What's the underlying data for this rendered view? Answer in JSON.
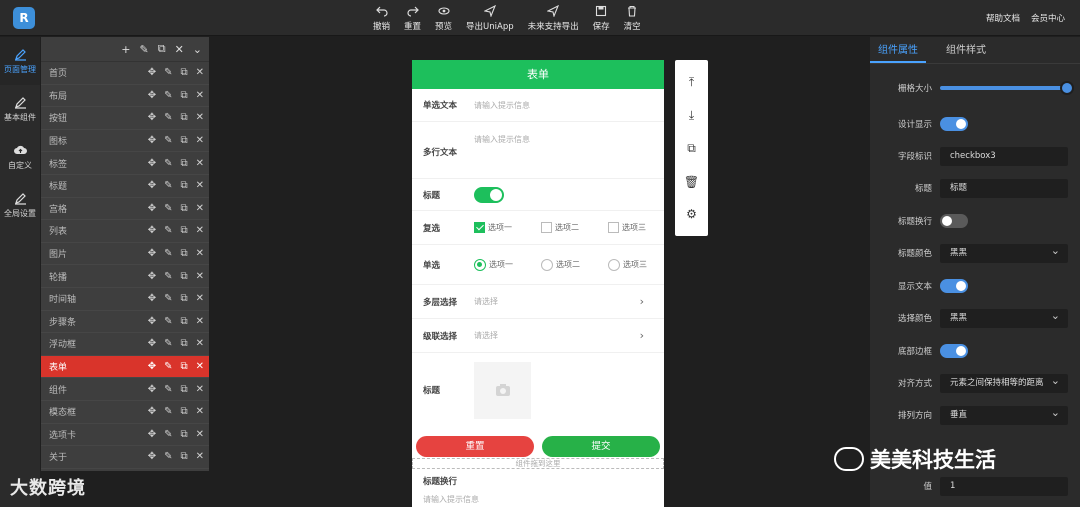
{
  "topbar": {
    "tools": [
      {
        "label": "撤销",
        "icon": "undo-icon"
      },
      {
        "label": "重置",
        "icon": "redo-icon"
      },
      {
        "label": "预览",
        "icon": "eye-icon"
      },
      {
        "label": "导出UniApp",
        "icon": "send-icon"
      },
      {
        "label": "未来支持导出",
        "icon": "send-icon"
      },
      {
        "label": "保存",
        "icon": "save-icon"
      },
      {
        "label": "清空",
        "icon": "trash-icon"
      }
    ],
    "help": "帮助文档",
    "member": "会员中心"
  },
  "rail": [
    {
      "label": "页面管理",
      "icon": "pen-icon"
    },
    {
      "label": "基本组件",
      "icon": "pen-icon"
    },
    {
      "label": "自定义",
      "icon": "cloud-upload-icon"
    },
    {
      "label": "全局设置",
      "icon": "pen-icon"
    }
  ],
  "pages": [
    "首页",
    "布局",
    "按钮",
    "图标",
    "标签",
    "标题",
    "宫格",
    "列表",
    "图片",
    "轮播",
    "时间轴",
    "步骤条",
    "浮动框",
    "表单",
    "组件",
    "模态框",
    "选项卡",
    "关于"
  ],
  "active_page": "表单",
  "form": {
    "title": "表单",
    "single_text": {
      "label": "单选文本",
      "placeholder": "请输入提示信息"
    },
    "multi_text": {
      "label": "多行文本",
      "placeholder": "请输入提示信息"
    },
    "toggle": {
      "label": "标题"
    },
    "checkbox": {
      "label": "复选",
      "options": [
        "选项一",
        "选项二",
        "选项三"
      ]
    },
    "radio": {
      "label": "单选",
      "options": [
        "选项一",
        "选项二",
        "选项三"
      ]
    },
    "multilevel": {
      "label": "多层选择",
      "placeholder": "请选择"
    },
    "cascade": {
      "label": "级联选择",
      "placeholder": "请选择"
    },
    "image": {
      "label": "标题"
    },
    "reset": "重置",
    "submit": "提交",
    "drop_hint": "组件拖到这里",
    "extra_label": "标题换行",
    "extra_placeholder": "请输入提示信息"
  },
  "props": {
    "tabs": [
      "组件属性",
      "组件样式"
    ],
    "grid_size_label": "栅格大小",
    "design_display_label": "设计显示",
    "field_id_label": "字段标识",
    "field_id_value": "checkbox3",
    "title_label": "标题",
    "title_value": "标题",
    "title_wrap_label": "标题换行",
    "title_color_label": "标题颜色",
    "title_color_value": "黑黑",
    "show_text_label": "显示文本",
    "select_color_label": "选择颜色",
    "select_color_value": "黑黑",
    "bottom_border_label": "底部边框",
    "align_label": "对齐方式",
    "align_value": "元素之间保持相等的距离",
    "direction_label": "排列方向",
    "direction_value": "垂直",
    "value_label": "值",
    "value_value": "1"
  },
  "watermark_left": "大数跨境",
  "watermark_right": "美美科技生活"
}
